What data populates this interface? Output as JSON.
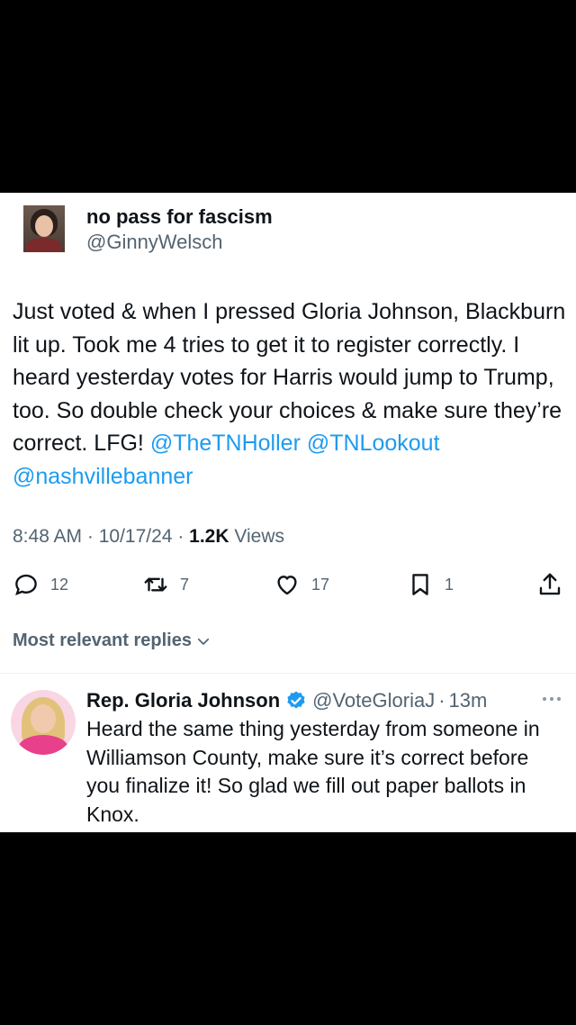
{
  "tweet": {
    "author_name": "no pass for fascism",
    "author_handle": "@GinnyWelsch",
    "text_before": "Just voted & when I pressed Gloria Johnson, Blackburn lit up. Took me 4 tries to get it to register correctly. I heard yesterday votes for Harris would jump to Trump, too. So double check your choices & make sure they’re correct. LFG! ",
    "mentions": [
      "@TheTNHoller",
      "@TNLookout",
      "@nashvillebanner"
    ],
    "time": "8:48 AM",
    "date": "10/17/24",
    "views_count": "1.2K",
    "views_label": "Views",
    "meta_separator": " · "
  },
  "actions": {
    "replies": "12",
    "retweets": "7",
    "likes": "17",
    "bookmarks": "1"
  },
  "replies_section": {
    "label": "Most relevant replies"
  },
  "reply": {
    "name": "Rep. Gloria Johnson",
    "handle": "@VoteGloriaJ",
    "separator": "·",
    "time": "13m",
    "text": "Heard the same thing yesterday from someone in Williamson County, make sure it’s correct before you finalize it! So glad we fill out paper ballots in Knox."
  },
  "colors": {
    "background": "#000000",
    "card": "#ffffff",
    "text": "#0f1419",
    "secondary": "#536471",
    "link": "#1d9bf0",
    "verified": "#1d9bf0"
  }
}
